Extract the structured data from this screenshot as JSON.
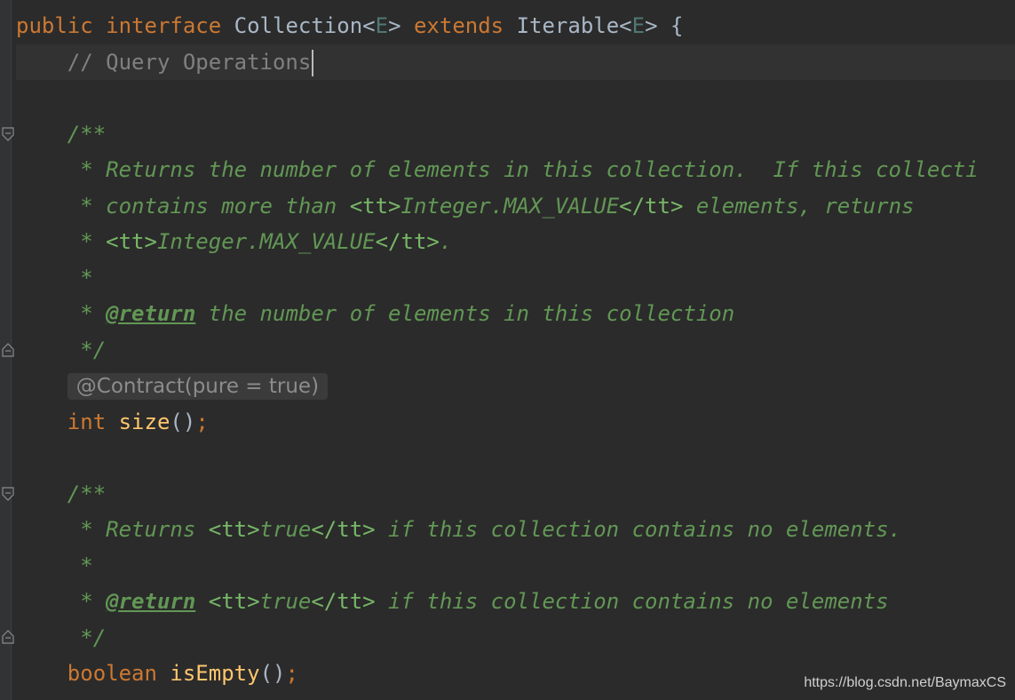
{
  "code": {
    "l1": {
      "kw1": "public",
      "kw2": "interface",
      "name": "Collection",
      "lt1": "<",
      "tp1": "E",
      "gt1": ">",
      "kw3": "extends",
      "parent": "Iterable",
      "lt2": "<",
      "tp2": "E",
      "gt2": ">",
      "brace": "{"
    },
    "l2": {
      "comment": "// Query Operations"
    },
    "c1_open": "/**",
    "c1_l1": " * Returns the number of elements in this collection.  If this collecti",
    "c1_l2": {
      "star": " * ",
      "a": "contains more than ",
      "h1": "<tt>",
      "b": "Integer.MAX_VALUE",
      "h2": "</tt>",
      "c": " elements, returns"
    },
    "c1_l3": {
      "star": " * ",
      "h1": "<tt>",
      "b": "Integer.MAX_VALUE",
      "h2": "</tt>",
      "c": "."
    },
    "c1_l4": " *",
    "c1_l5": {
      "star": " * ",
      "tag": "@return",
      "text": " the number of elements in this collection"
    },
    "c1_close": " */",
    "annotation": "@Contract(pure = true)",
    "size_decl": {
      "type": "int",
      "name": "size",
      "paren": "()",
      "semi": ";"
    },
    "c2_open": "/**",
    "c2_l1": {
      "a": " * Returns ",
      "h1": "<tt>",
      "b": "true",
      "h2": "</tt>",
      "c": " if this collection contains no elements."
    },
    "c2_l2": " *",
    "c2_l3": {
      "star": " * ",
      "tag": "@return",
      "sp": " ",
      "h1": "<tt>",
      "b": "true",
      "h2": "</tt>",
      "c": " if this collection contains no elements"
    },
    "c2_close": " */",
    "isempty_decl": {
      "type": "boolean",
      "name": "isEmpty",
      "paren": "()",
      "semi": ";"
    }
  },
  "gutter": {
    "fold_icon": "fold-toggle-icon"
  },
  "watermark": "https://blog.csdn.net/BaymaxCS",
  "colors": {
    "background": "#2b2b2b",
    "keyword": "#cc7832",
    "doc_comment": "#629755",
    "line_comment": "#808080",
    "method": "#ffc66d",
    "type_param": "#507874"
  }
}
